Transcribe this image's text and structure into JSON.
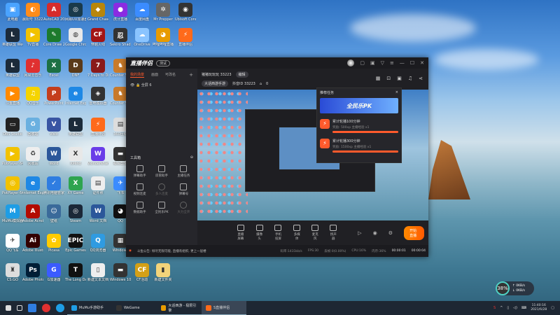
{
  "desktop": {
    "icons": [
      [
        "此电脑",
        "#4aa3ff",
        "▣"
      ],
      [
        "晨阳号 33223",
        "#ff8c1a",
        "◐"
      ],
      [
        "AutoCAD 2020",
        "#d62b2b",
        "A"
      ],
      [
        "网易UU加速器",
        "#1a3a4a",
        "◎"
      ],
      [
        "Grand Chase",
        "#b8860b",
        "◆"
      ],
      [
        "虎牙直播",
        "#8a2be2",
        "●"
      ],
      [
        "百度网盘",
        "#3b8cff",
        "☁"
      ],
      [
        "Mr Prepper",
        "#666",
        "✲"
      ],
      [
        "Ubisoft Connect",
        "#333",
        "◉"
      ],
      [
        "英雄联盟 WeGame版",
        "#1c2b3a",
        "L"
      ],
      [
        "TV直播",
        "#f2c200",
        "▶"
      ],
      [
        "Core Draw 2019",
        "#1c7a2c",
        "✎"
      ],
      [
        "Google Chrome",
        "#e8e8e8",
        "◍"
      ],
      [
        "穿越火线",
        "#a31515",
        "CF"
      ],
      [
        "Sekiro Shadows",
        "#333",
        "忍"
      ],
      [
        "OneDrive",
        "#8ac4ff",
        "☁"
      ],
      [
        "哔哩哔哩直播",
        "#e89b00",
        "◕"
      ],
      [
        "直播伴侣",
        "#ff6a1a",
        "⚡"
      ],
      [
        "英雄联盟",
        "#1c2b3a",
        "L"
      ],
      [
        "网易云音乐",
        "#e03030",
        "♪"
      ],
      [
        "Excel",
        "#1d7044",
        "X"
      ],
      [
        "DNF",
        "#5a3a1a",
        "D"
      ],
      [
        "7 Days to Die",
        "#8a1a1a",
        "7"
      ],
      [
        "Counter Strike",
        "#c87a2a",
        "♞"
      ],
      [
        "",
        "",
        ""
      ],
      [
        "",
        "",
        ""
      ],
      [
        "",
        "",
        ""
      ],
      [
        "斗鱼直播",
        "#ff8a00",
        "▶"
      ],
      [
        "QQ音乐",
        "#f5d400",
        "♫"
      ],
      [
        "PowerPoint",
        "#c43e1c",
        "P"
      ],
      [
        "Internet Explorer",
        "#1e88e5",
        "e"
      ],
      [
        "雷电模拟器",
        "#333",
        "◈"
      ],
      [
        "Counter Strike",
        "#c87a2a",
        "♞"
      ],
      [
        "",
        "",
        ""
      ],
      [
        "",
        "",
        ""
      ],
      [
        "",
        "",
        ""
      ],
      [
        "OBS Studio",
        "#222",
        "▭"
      ],
      [
        "回收站",
        "#6ab0e0",
        "♻"
      ],
      [
        "Visio",
        "#3955a3",
        "V"
      ],
      [
        "英雄联盟",
        "#1c2b3a",
        "L"
      ],
      [
        "直播伴侣",
        "#ff6a1a",
        "⚡"
      ],
      [
        "360压缩",
        "#ddd",
        "▤"
      ],
      [
        "",
        "",
        ""
      ],
      [
        "",
        "",
        ""
      ],
      [
        "",
        "",
        ""
      ],
      [
        "PotPlayer 64",
        "#f2c200",
        "▶"
      ],
      [
        "回收站",
        "#eee",
        "♻"
      ],
      [
        "Word",
        "#2b579a",
        "W"
      ],
      [
        "XMind",
        "#e8e8e8",
        "X"
      ],
      [
        "Wondershare",
        "#6a3de8",
        "W"
      ],
      [
        "视频剪辑",
        "#333",
        "▬"
      ],
      [
        "",
        "",
        ""
      ],
      [
        "",
        "",
        ""
      ],
      [
        "",
        "",
        ""
      ],
      [
        "PotPlayer 64",
        "#f2c200",
        "◎"
      ],
      [
        "Internet Explorer",
        "#1e88e5",
        "e"
      ],
      [
        "腾讯电脑管家",
        "#2f7de1",
        "✓"
      ],
      [
        "XY Game",
        "#2ea44f",
        "X"
      ],
      [
        "证件照",
        "#eee",
        "▤"
      ],
      [
        "飞书",
        "#3b8cff",
        "✈"
      ],
      [
        "",
        "",
        ""
      ],
      [
        "",
        "",
        ""
      ],
      [
        "",
        "",
        ""
      ],
      [
        "MuMu模拟器",
        "#1e9de5",
        "M"
      ],
      [
        "Adobe Acrobat DC",
        "#b30b00",
        "A"
      ],
      [
        "壁纸",
        "#3a6a9a",
        "☺"
      ],
      [
        "Steam",
        "#1b2838",
        "◎"
      ],
      [
        "Word 文档",
        "#2b579a",
        "W"
      ],
      [
        "QQ",
        "#111",
        "◕"
      ],
      [
        "",
        "",
        ""
      ],
      [
        "",
        "",
        ""
      ],
      [
        "",
        "",
        ""
      ],
      [
        "QQ飞车",
        "#fff",
        "✈"
      ],
      [
        "Adobe Illustrator",
        "#330000",
        "Ai"
      ],
      [
        "Picasa",
        "#ffcc00",
        "✿"
      ],
      [
        "Epic Games",
        "#111",
        "EPIC"
      ],
      [
        "QQ浏览器",
        "#2f9be1",
        "Q"
      ],
      [
        "Windows",
        "#333",
        "▦"
      ],
      [
        "",
        "",
        ""
      ],
      [
        "",
        "",
        ""
      ],
      [
        "",
        "",
        ""
      ],
      [
        "CS:GO",
        "#ddd",
        "♜"
      ],
      [
        "Adobe Photoshop",
        "#001e36",
        "Ps"
      ],
      [
        "G加速器",
        "#3b5bff",
        "G"
      ],
      [
        "The Long Dark",
        "#111",
        "T"
      ],
      [
        "新建文本文档",
        "#eee",
        "▯"
      ],
      [
        "Windows 10",
        "#333",
        "▬"
      ],
      [
        "CF活动",
        "#d4a017",
        "CF"
      ],
      [
        "新建文件夹",
        "#f3d37a",
        "▮"
      ]
    ]
  },
  "app": {
    "title": "直播伴侣",
    "version_badge": "测试",
    "tabs": [
      "我的场景",
      "画面",
      "可改名"
    ],
    "add": "+",
    "scene": "全屏 6",
    "toolbox_title": "工具箱",
    "tools": [
      {
        "label": "弹幕助手"
      },
      {
        "label": "房管助手"
      },
      {
        "label": "主播任务"
      },
      {
        "label": "视频连麦"
      },
      {
        "label": "多人连麦",
        "dim": true
      },
      {
        "label": "弹幕号"
      },
      {
        "label": "数据助手"
      },
      {
        "label": "全民乐PK"
      },
      {
        "label": "大力全开",
        "dim": true
      }
    ],
    "room_title": "猪猪玩玩玩 33223",
    "edit_badge": "编辑",
    "category": "大话西游手游",
    "id_label": "抖音ID 33223",
    "online_count": "0",
    "bottom_buttons": [
      "直播屏幕",
      "摄像头",
      "手机投屏",
      "多媒体",
      "麦克风",
      "扬声器"
    ],
    "start_button": "开始直播",
    "notice": "斗鱼公告: 倾尽无限可能, 直播有组织, 更上一层楼",
    "stats": [
      "码率:1431kb/s",
      "FPS:30",
      "丢帧:0(0.00%)",
      "CPU:16%",
      "内存:36%"
    ],
    "live_time": "00:00:01",
    "record_time": "00:00:04"
  },
  "task_popup": {
    "title": "推荐任务",
    "close": "×",
    "banner": "全民乐PK",
    "tasks": [
      {
        "title": "累计轮播100分钟",
        "reward": "奖励: 500xp 主播经验 x1",
        "progress": 1.0
      },
      {
        "title": "累计轮播300分钟",
        "reward": "奖励: 1500xp 主播经验 x1",
        "progress": 1.0
      }
    ]
  },
  "net_widget": {
    "percent": "38%",
    "up": "↑ 0KB/s",
    "down": "↓ 0KB/s"
  },
  "taskbar": {
    "apps": [
      "MuMu手游助手",
      "WeGame",
      "大话西游 - 极限引擎",
      "S直播伴侣"
    ],
    "time": "11:40:16",
    "date": "2021/6/28"
  },
  "colors": {
    "accent": "#ff5a2c",
    "window": "#202024"
  }
}
